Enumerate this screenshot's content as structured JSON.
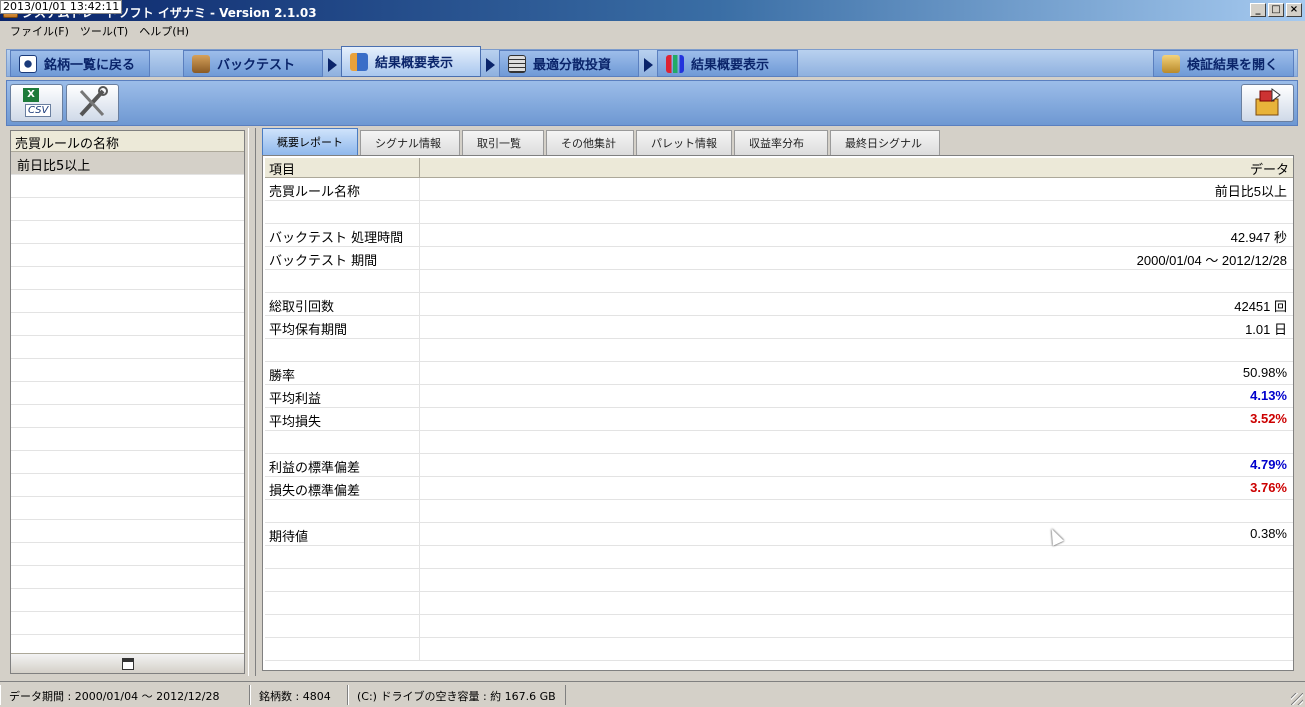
{
  "timestamp": "2013/01/01 13:42:11",
  "window": {
    "title": "システムトレードソフト イザナミ - Version 2.1.03",
    "buttons": [
      "_",
      "□",
      "×"
    ]
  },
  "menu": [
    "ファイル(F)",
    "ツール(T)",
    "ヘルプ(H)"
  ],
  "wizard_tabs": [
    {
      "label": "銘柄一覧に戻る",
      "icon": "eye-icon"
    },
    {
      "label": "バックテスト",
      "icon": "backpack-icon"
    },
    {
      "label": "結果概要表示",
      "icon": "chart-hand-icon",
      "active": true
    },
    {
      "label": "最適分散投資",
      "icon": "grid-icon"
    },
    {
      "label": "結果概要表示",
      "icon": "bar-chart-icon"
    },
    {
      "label": "検証結果を開く",
      "icon": "open-folder-icon"
    }
  ],
  "toolbar": {
    "csv_label": "CSV",
    "tools_icon": "tools-icon",
    "export_icon": "export-icon"
  },
  "left_panel": {
    "header": "売買ルールの名称",
    "rows": [
      "前日比5以上"
    ]
  },
  "sub_tabs": [
    "概要レポート",
    "シグナル情報",
    "取引一覧",
    "その他集計",
    "パレット情報",
    "収益率分布",
    "最終日シグナル"
  ],
  "grid": {
    "col_item": "項目",
    "col_data": "データ",
    "rows": [
      {
        "item": "売買ルール名称",
        "data": "前日比5以上",
        "tone": ""
      },
      {
        "item": "",
        "data": "",
        "tone": ""
      },
      {
        "item": "バックテスト 処理時間",
        "data": "42.947 秒",
        "tone": ""
      },
      {
        "item": "バックテスト 期間",
        "data": "2000/01/04 ～ 2012/12/28",
        "tone": ""
      },
      {
        "item": "",
        "data": "",
        "tone": ""
      },
      {
        "item": "総取引回数",
        "data": "42451 回",
        "tone": ""
      },
      {
        "item": "平均保有期間",
        "data": "1.01 日",
        "tone": ""
      },
      {
        "item": "",
        "data": "",
        "tone": ""
      },
      {
        "item": "勝率",
        "data": "50.98%",
        "tone": ""
      },
      {
        "item": "平均利益",
        "data": "4.13%",
        "tone": "pos"
      },
      {
        "item": "平均損失",
        "data": "3.52%",
        "tone": "neg"
      },
      {
        "item": "",
        "data": "",
        "tone": ""
      },
      {
        "item": "利益の標準偏差",
        "data": "4.79%",
        "tone": "pos"
      },
      {
        "item": "損失の標準偏差",
        "data": "3.76%",
        "tone": "neg"
      },
      {
        "item": "",
        "data": "",
        "tone": ""
      },
      {
        "item": "期待値",
        "data": "0.38%",
        "tone": ""
      },
      {
        "item": "",
        "data": "",
        "tone": ""
      },
      {
        "item": "",
        "data": "",
        "tone": ""
      },
      {
        "item": "",
        "data": "",
        "tone": ""
      },
      {
        "item": "",
        "data": "",
        "tone": ""
      },
      {
        "item": "",
        "data": "",
        "tone": ""
      }
    ]
  },
  "status": {
    "data_period": "データ期間 : 2000/01/04 ～ 2012/12/28",
    "symbol_count": "銘柄数 : 4804",
    "free_space": "(C:) ドライブの空き容量 : 約 167.6 GB"
  },
  "colors": {
    "positive": "#0000cc",
    "negative": "#cc0000"
  }
}
